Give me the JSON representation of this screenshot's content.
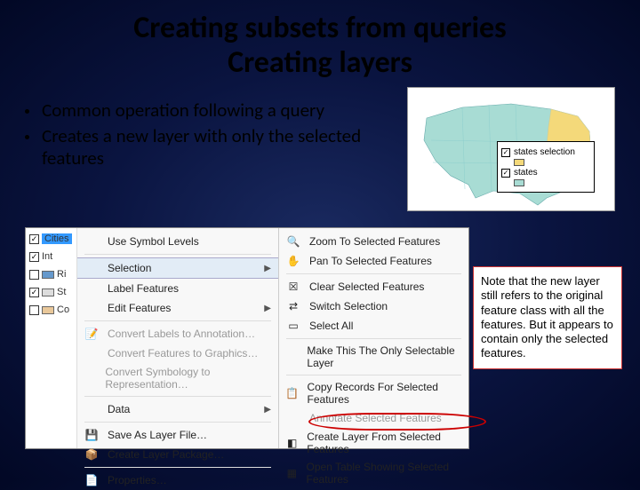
{
  "title_line1": "Creating subsets from queries",
  "title_line2": "Creating layers",
  "bullets": [
    "Common operation following a query",
    "Creates a new layer with only the selected features"
  ],
  "legend": {
    "item1": "states selection",
    "item2": "states"
  },
  "toc": {
    "r0": "Cities",
    "r1": "Int",
    "r2": "Ri",
    "r3": "St",
    "r4": "Co"
  },
  "menu1": {
    "use_symbol_levels": "Use Symbol Levels",
    "selection": "Selection",
    "label_features": "Label Features",
    "edit_features": "Edit Features",
    "convert_labels": "Convert Labels to Annotation…",
    "convert_features": "Convert Features to Graphics…",
    "convert_symb": "Convert Symbology to Representation…",
    "data": "Data",
    "save_as_layer": "Save As Layer File…",
    "create_layer_pkg": "Create Layer Package…",
    "properties": "Properties…"
  },
  "menu2": {
    "zoom": "Zoom To Selected Features",
    "pan": "Pan To Selected Features",
    "clear": "Clear Selected Features",
    "switch": "Switch Selection",
    "select_all": "Select All",
    "make_only": "Make This The Only Selectable Layer",
    "copy_records": "Copy Records For Selected Features",
    "create_layer": "Create Layer From Selected Features",
    "open_table": "Open Table Showing Selected Features"
  },
  "note": "Note that the new layer still refers to the original feature class with all the features.  But it appears to contain only the selected features.",
  "colors": {
    "map_fill": "#a8dcd4",
    "highlight": "#f4d97a"
  }
}
